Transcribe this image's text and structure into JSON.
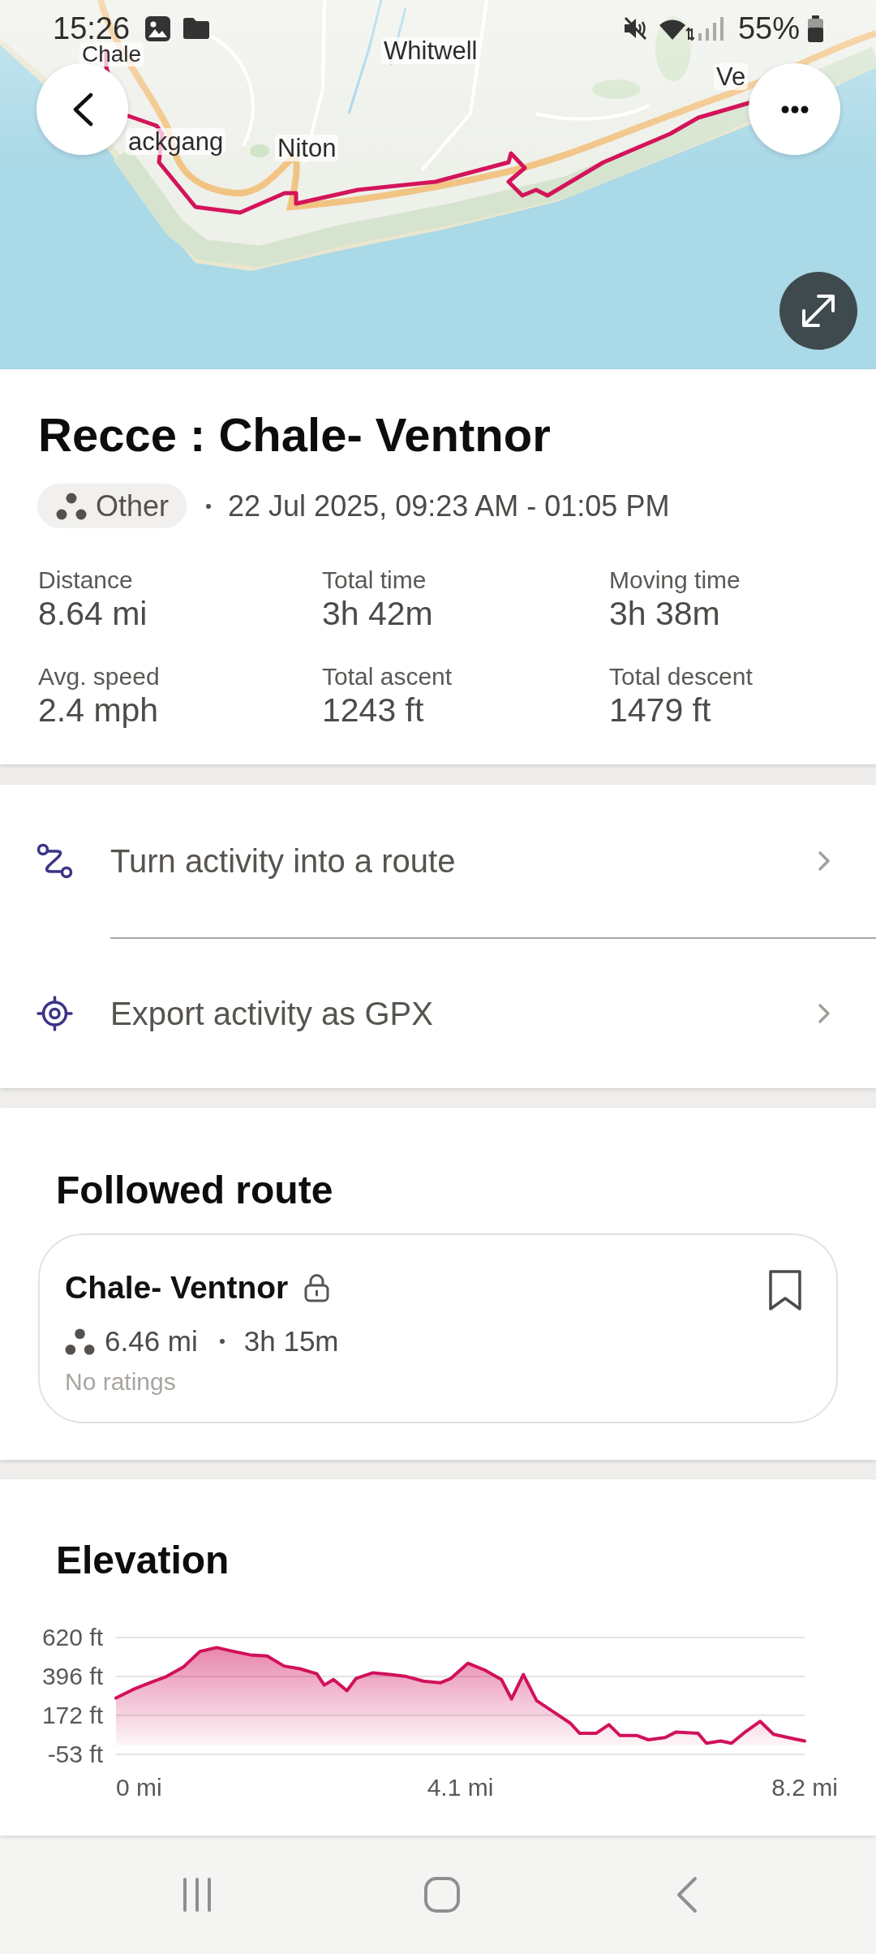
{
  "status_bar": {
    "time": "15:26",
    "battery": "55%"
  },
  "map": {
    "labels": [
      "Chale",
      "Whitwell",
      "ackgang",
      "Niton",
      "Ve"
    ]
  },
  "activity": {
    "title": "Recce : Chale- Ventnor",
    "type": "Other",
    "date": "22 Jul 2025, 09:23 AM - 01:05 PM",
    "stats": [
      {
        "label": "Distance",
        "value": "8.64 mi"
      },
      {
        "label": "Total time",
        "value": "3h 42m"
      },
      {
        "label": "Moving time",
        "value": "3h 38m"
      },
      {
        "label": "Avg. speed",
        "value": "2.4 mph"
      },
      {
        "label": "Total ascent",
        "value": "1243 ft"
      },
      {
        "label": "Total descent",
        "value": "1479 ft"
      }
    ]
  },
  "actions": [
    {
      "kind": "route",
      "label": "Turn activity into a route"
    },
    {
      "kind": "export",
      "label": "Export activity as GPX"
    }
  ],
  "followed_route": {
    "heading": "Followed route",
    "name": "Chale- Ventnor",
    "locked": true,
    "bookmarked": false,
    "distance": "6.46 mi",
    "duration": "3h 15m",
    "rating": "No ratings"
  },
  "elevation": {
    "heading": "Elevation",
    "chart_data": {
      "type": "area",
      "x": [
        0,
        0.2,
        0.4,
        0.6,
        0.8,
        1.0,
        1.2,
        1.4,
        1.6,
        1.8,
        2.0,
        2.19,
        2.39,
        2.48,
        2.59,
        2.75,
        2.86,
        3.06,
        3.26,
        3.46,
        3.66,
        3.86,
        3.99,
        4.19,
        4.39,
        4.59,
        4.71,
        4.85,
        5.01,
        5.21,
        5.41,
        5.52,
        5.72,
        5.87,
        6.0,
        6.2,
        6.34,
        6.54,
        6.67,
        6.93,
        7.03,
        7.2,
        7.33,
        7.5,
        7.67,
        7.83,
        8.07,
        8.2
      ],
      "series": [
        {
          "color": "#d1105b",
          "values": [
            272,
            320,
            359,
            395,
            449,
            540,
            562,
            540,
            520,
            514,
            456,
            440,
            411,
            346,
            378,
            314,
            385,
            417,
            407,
            395,
            369,
            359,
            385,
            472,
            433,
            378,
            266,
            407,
            256,
            192,
            127,
            69,
            69,
            118,
            56,
            56,
            31,
            44,
            76,
            69,
            11,
            24,
            11,
            79,
            137,
            63,
            37,
            24
          ]
        }
      ],
      "xlim": [
        0,
        8.2
      ],
      "ylim": [
        -53,
        620
      ],
      "xticks": [
        {
          "value": 0,
          "label": "0 mi"
        },
        {
          "value": 4.1,
          "label": "4.1 mi"
        },
        {
          "value": 8.2,
          "label": "8.2 mi"
        }
      ],
      "yticks": [
        {
          "value": 620,
          "label": "620 ft"
        },
        {
          "value": 396,
          "label": "396 ft"
        },
        {
          "value": 172,
          "label": "172 ft"
        },
        {
          "value": -53,
          "label": "-53 ft"
        }
      ]
    }
  }
}
